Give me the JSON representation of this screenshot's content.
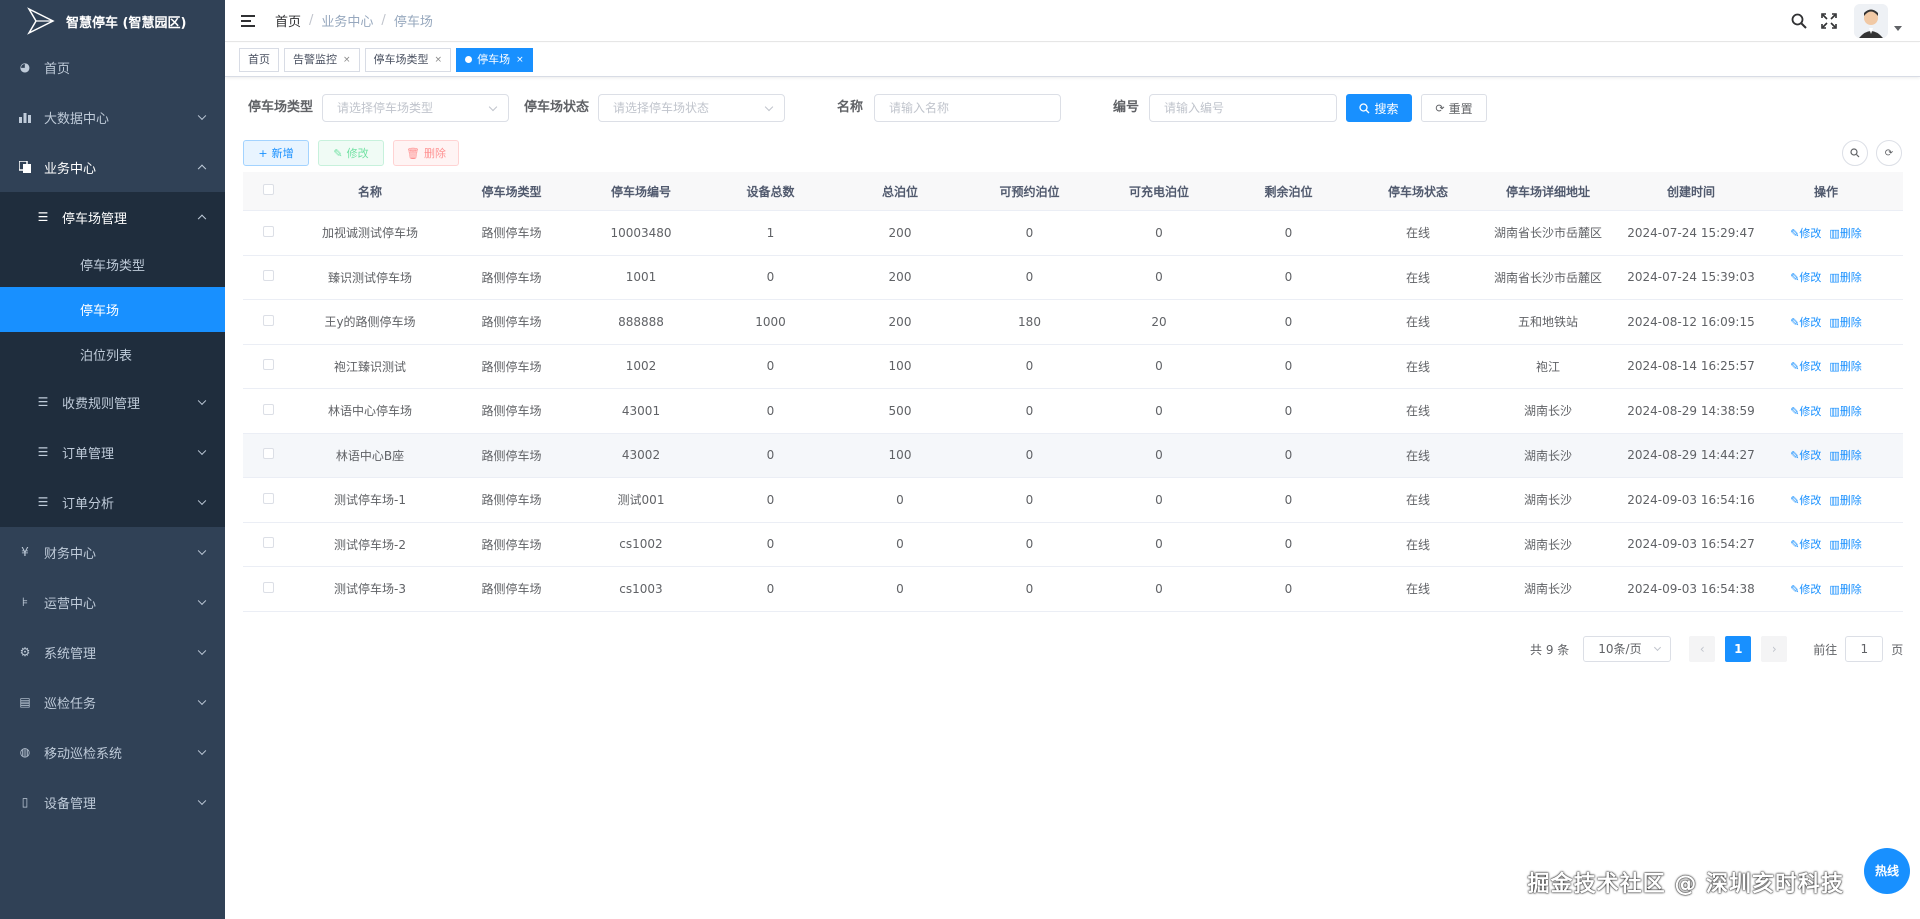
{
  "app": {
    "title": "智慧停车 (智慧园区)"
  },
  "sidebar": {
    "items": [
      {
        "label": "首页",
        "icon": "dashboard-icon"
      },
      {
        "label": "大数据中心",
        "icon": "bar-chart-icon"
      },
      {
        "label": "业务中心",
        "icon": "copy-icon",
        "expanded": true
      },
      {
        "label": "停车场管理",
        "icon": "list-icon",
        "expanded": true
      },
      {
        "label": "停车场类型"
      },
      {
        "label": "停车场",
        "active": true
      },
      {
        "label": "泊位列表"
      },
      {
        "label": "收费规则管理",
        "icon": "list-icon"
      },
      {
        "label": "订单管理",
        "icon": "list-icon"
      },
      {
        "label": "订单分析",
        "icon": "list-icon"
      },
      {
        "label": "财务中心",
        "icon": "yen-icon"
      },
      {
        "label": "运营中心",
        "icon": "tree-icon"
      },
      {
        "label": "系统管理",
        "icon": "gear-icon"
      },
      {
        "label": "巡检任务",
        "icon": "document-icon"
      },
      {
        "label": "移动巡检系统",
        "icon": "globe-icon"
      },
      {
        "label": "设备管理",
        "icon": "phone-icon"
      }
    ]
  },
  "breadcrumb": [
    "首页",
    "业务中心",
    "停车场"
  ],
  "tags": [
    {
      "label": "首页"
    },
    {
      "label": "告警监控"
    },
    {
      "label": "停车场类型"
    },
    {
      "label": "停车场",
      "active": true
    }
  ],
  "search": {
    "type_label": "停车场类型",
    "type_placeholder": "请选择停车场类型",
    "status_label": "停车场状态",
    "status_placeholder": "请选择停车场状态",
    "name_label": "名称",
    "name_placeholder": "请输入名称",
    "code_label": "编号",
    "code_placeholder": "请输入编号",
    "search_btn": "搜索",
    "reset_btn": "重置"
  },
  "toolbar": {
    "add": "新增",
    "edit": "修改",
    "delete": "删除"
  },
  "table": {
    "columns": [
      "名称",
      "停车场类型",
      "停车场编号",
      "设备总数",
      "总泊位",
      "可预约泊位",
      "可充电泊位",
      "剩余泊位",
      "停车场状态",
      "停车场详细地址",
      "创建时间",
      "操作"
    ],
    "rows": [
      [
        "加视诚测试停车场",
        "路侧停车场",
        "10003480",
        "1",
        "200",
        "0",
        "0",
        "0",
        "在线",
        "湖南省长沙市岳麓区",
        "2024-07-24 15:29:47"
      ],
      [
        "臻识测试停车场",
        "路侧停车场",
        "1001",
        "0",
        "200",
        "0",
        "0",
        "0",
        "在线",
        "湖南省长沙市岳麓区",
        "2024-07-24 15:39:03"
      ],
      [
        "王y的路侧停车场",
        "路侧停车场",
        "888888",
        "1000",
        "200",
        "180",
        "20",
        "0",
        "在线",
        "五和地铁站",
        "2024-08-12 16:09:15"
      ],
      [
        "袍江臻识测试",
        "路侧停车场",
        "1002",
        "0",
        "100",
        "0",
        "0",
        "0",
        "在线",
        "袍江",
        "2024-08-14 16:25:57"
      ],
      [
        "林语中心停车场",
        "路侧停车场",
        "43001",
        "0",
        "500",
        "0",
        "0",
        "0",
        "在线",
        "湖南长沙",
        "2024-08-29 14:38:59"
      ],
      [
        "林语中心B座",
        "路侧停车场",
        "43002",
        "0",
        "100",
        "0",
        "0",
        "0",
        "在线",
        "湖南长沙",
        "2024-08-29 14:44:27"
      ],
      [
        "测试停车场-1",
        "路侧停车场",
        "测试001",
        "0",
        "0",
        "0",
        "0",
        "0",
        "在线",
        "湖南长沙",
        "2024-09-03 16:54:16"
      ],
      [
        "测试停车场-2",
        "路侧停车场",
        "cs1002",
        "0",
        "0",
        "0",
        "0",
        "0",
        "在线",
        "湖南长沙",
        "2024-09-03 16:54:27"
      ],
      [
        "测试停车场-3",
        "路侧停车场",
        "cs1003",
        "0",
        "0",
        "0",
        "0",
        "0",
        "在线",
        "湖南长沙",
        "2024-09-03 16:54:38"
      ]
    ],
    "op_edit": "修改",
    "op_delete": "删除"
  },
  "pagination": {
    "total": "共 9 条",
    "page_size": "10条/页",
    "current": "1",
    "goto_prefix": "前往",
    "goto_value": "1",
    "goto_suffix": "页"
  },
  "watermark": "掘金技术社区 @ 深圳亥时科技",
  "hotline": "热线"
}
